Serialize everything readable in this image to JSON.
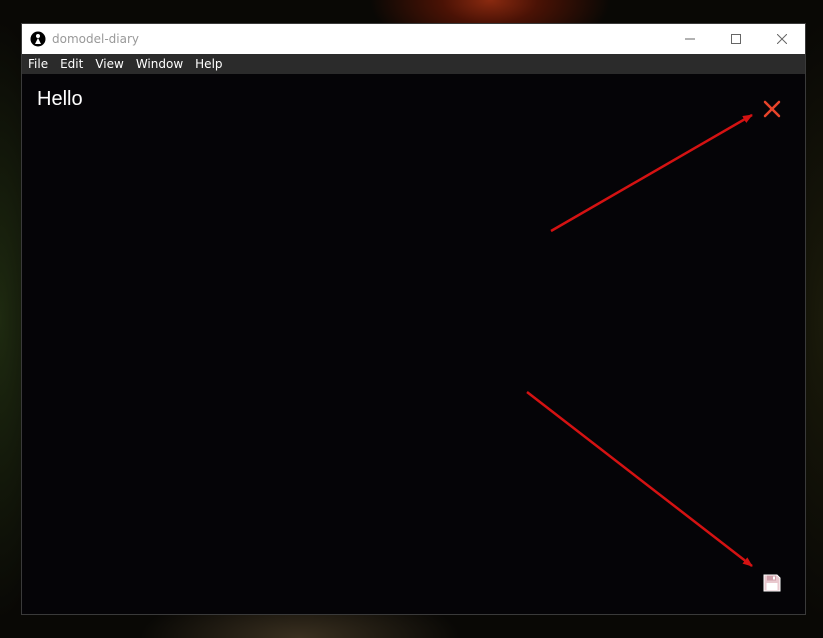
{
  "window": {
    "title": "domodel-diary",
    "controls": [
      "minimize-icon",
      "maximize-icon",
      "close-icon"
    ]
  },
  "menu": {
    "items": [
      {
        "label": "File"
      },
      {
        "label": "Edit"
      },
      {
        "label": "View"
      },
      {
        "label": "Window"
      },
      {
        "label": "Help"
      }
    ]
  },
  "note": {
    "title": "Hello",
    "close_icon": "close-x-icon",
    "save_icon": "floppy-disk-icon"
  },
  "colors": {
    "accent": "#e8442a",
    "arrow": "#d41212",
    "window_bg": "#050407",
    "menubar_bg": "#2b2b2b"
  }
}
